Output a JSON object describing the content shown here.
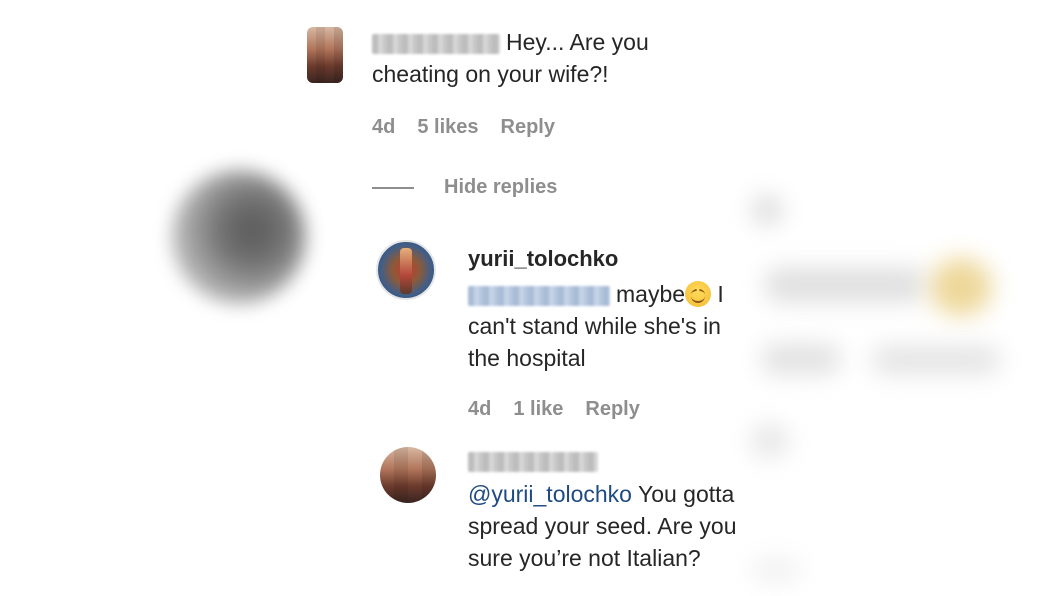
{
  "comment_top": {
    "text": "Hey... Are you cheating on your wife?!",
    "time": "4d",
    "likes": "5 likes",
    "reply": "Reply"
  },
  "thread": {
    "hide_replies": "Hide replies"
  },
  "reply_1": {
    "username": "yurii_tolochko",
    "text_before": "maybe",
    "emoji": "smiling-face-emoji",
    "text_after": " I can't stand while she's in the hospital",
    "time": "4d",
    "likes": "1 like",
    "reply": "Reply"
  },
  "reply_2": {
    "mention": "@yurii_tolochko",
    "text": " You gotta spread your seed. Are you sure you’re not Italian?"
  },
  "colors": {
    "text": "#262626",
    "meta": "#8e8e8e",
    "mention": "#1f4b82",
    "background": "#ffffff"
  }
}
